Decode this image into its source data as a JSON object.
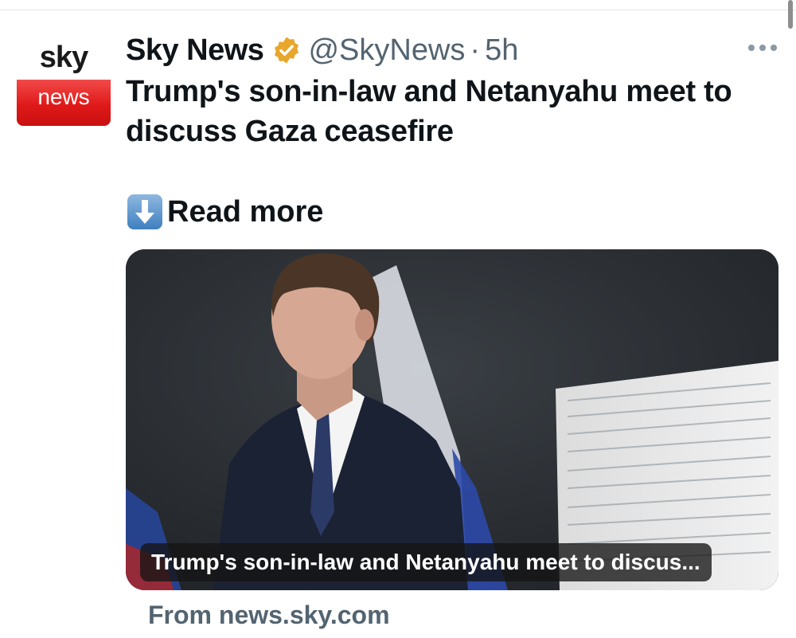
{
  "post": {
    "author_name": "Sky News",
    "author_handle": "@SkyNews",
    "separator": "·",
    "time": "5h",
    "avatar": {
      "top_text": "sky",
      "bottom_text": "news"
    },
    "verified_icon": "verified-badge-icon",
    "text": "Trump's son-in-law and Netanyahu meet to discuss Gaza ceasefire",
    "read_more_emoji": "down-arrow-emoji",
    "read_more": "Read more",
    "more_icon": "more-horizontal-icon"
  },
  "card": {
    "title": "Trump's son-in-law and Netanyahu meet to discus...",
    "source": "From news.sky.com"
  },
  "colors": {
    "brand_red": "#e01919",
    "verified_gold": "#e8a62a",
    "secondary_text": "#536471"
  }
}
